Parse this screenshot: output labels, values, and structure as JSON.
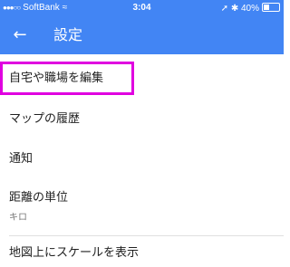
{
  "status_bar": {
    "signal": "●●●○○",
    "carrier": "SoftBank",
    "wifi": "≈",
    "time": "3:04",
    "right": "➚ ✱ 40%",
    "battery_level": 0.4
  },
  "app_bar": {
    "back_icon": "←",
    "title": "設定"
  },
  "menu": {
    "items": [
      {
        "label": "自宅や職場を編集",
        "highlighted": true
      },
      {
        "label": "マップの履歴"
      },
      {
        "label": "通知"
      },
      {
        "label": "距離の単位",
        "value": "キロ"
      },
      {
        "label": "地図上にスケールを表示"
      }
    ]
  },
  "colors": {
    "primary": "#4285f4",
    "highlight": "#e000e0",
    "text": "#212121",
    "secondary_text": "#757575"
  }
}
